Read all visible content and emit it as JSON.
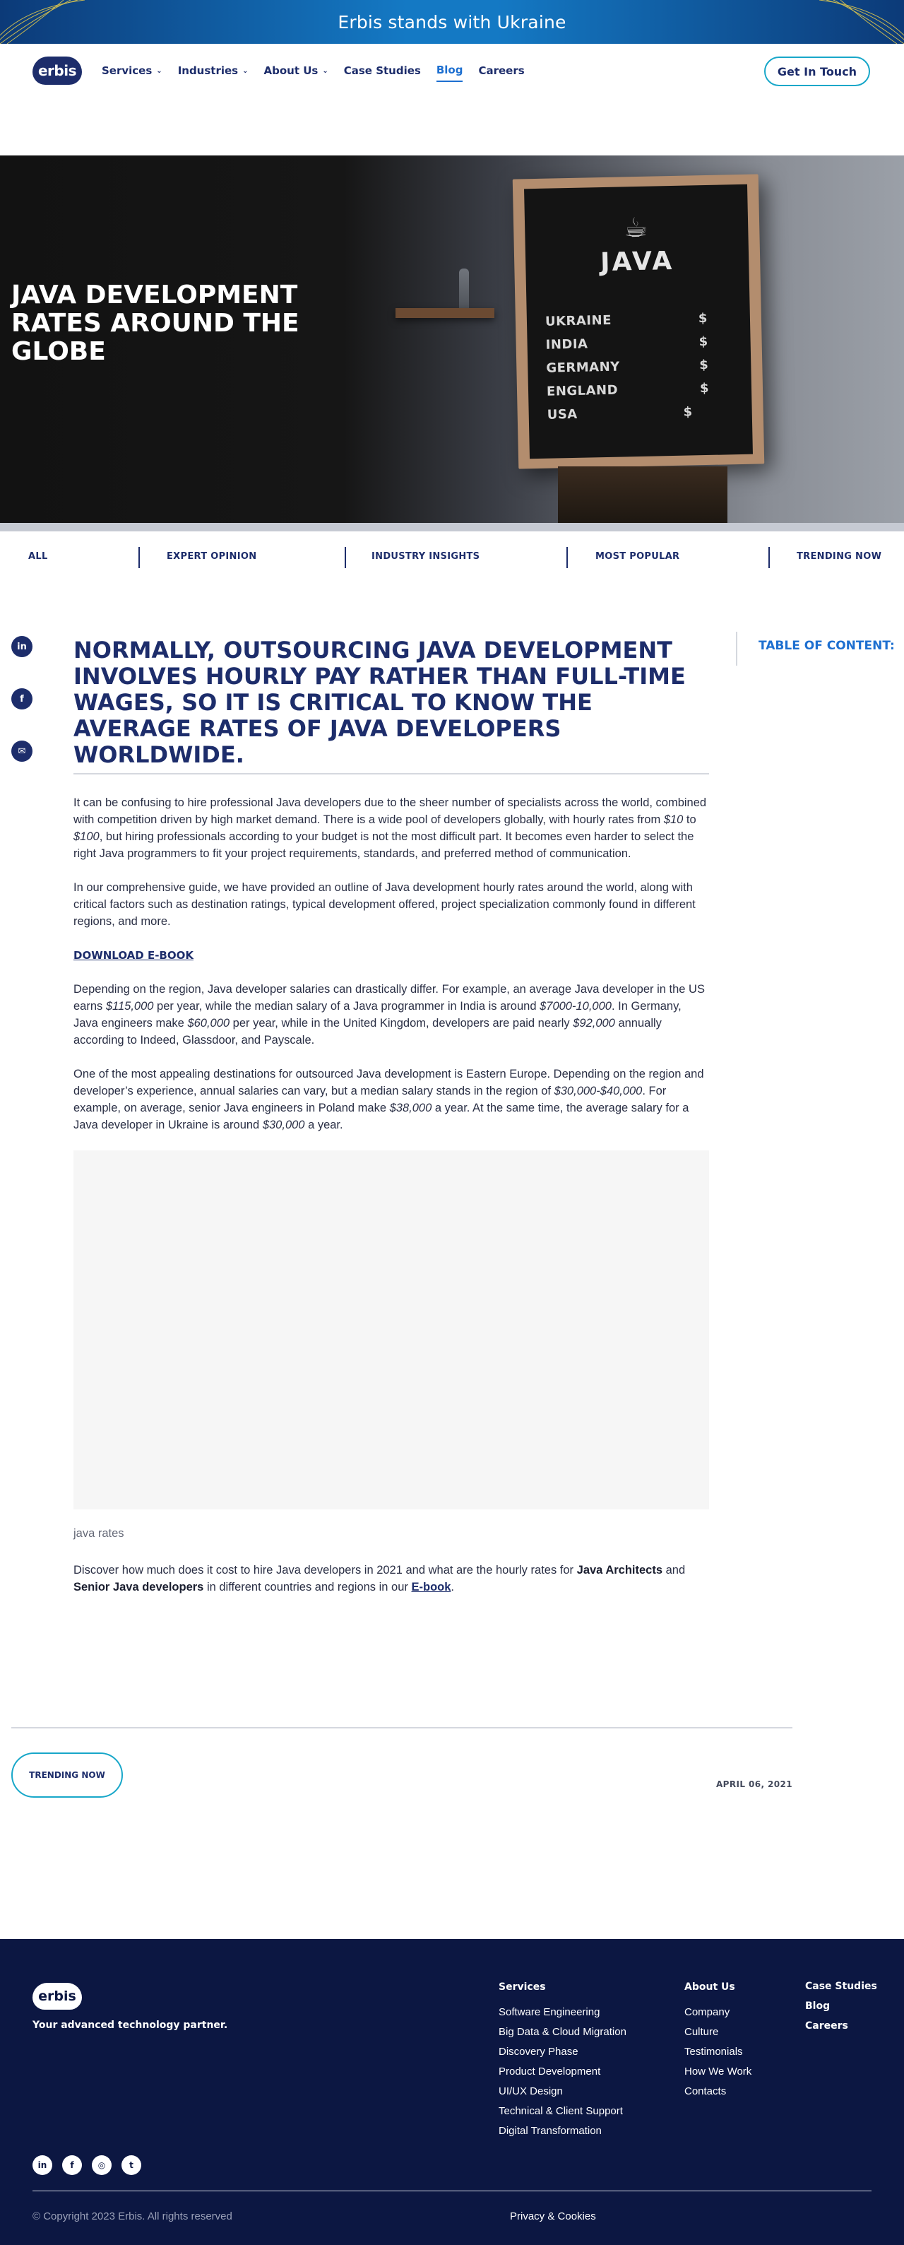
{
  "banner": {
    "text": "Erbis stands with Ukraine"
  },
  "header": {
    "logo": "erbis",
    "nav": [
      {
        "label": "Services",
        "dropdown": true
      },
      {
        "label": "Industries",
        "dropdown": true
      },
      {
        "label": "About Us",
        "dropdown": true
      },
      {
        "label": "Case Studies",
        "dropdown": false
      },
      {
        "label": "Blog",
        "dropdown": false,
        "active": true
      },
      {
        "label": "Careers",
        "dropdown": false
      }
    ],
    "cta": "Get In Touch"
  },
  "hero": {
    "title": "JAVA DEVELOPMENT RATES AROUND THE GLOBE",
    "board": {
      "heading": "JAVA",
      "rows": [
        {
          "country": "UKRAINE",
          "symbol": "$"
        },
        {
          "country": "INDIA",
          "symbol": "$"
        },
        {
          "country": "GERMANY",
          "symbol": "$"
        },
        {
          "country": "ENGLAND",
          "symbol": "$"
        },
        {
          "country": "USA",
          "symbol": "$"
        }
      ]
    }
  },
  "categories": [
    "ALL",
    "EXPERT OPINION",
    "INDUSTRY INSIGHTS",
    "MOST POPULAR",
    "TRENDING NOW"
  ],
  "article": {
    "title": "NORMALLY, OUTSOURCING JAVA DEVELOPMENT INVOLVES HOURLY PAY RATHER THAN FULL-TIME WAGES, SO IT IS CRITICAL TO KNOW THE AVERAGE RATES OF JAVA DEVELOPERS WORLDWIDE.",
    "toc_label": "TABLE OF CONTENT:",
    "p1": {
      "a": "It can be confusing to hire professional Java developers due to the sheer number of specialists across the world, combined with competition driven by high market demand. There is a wide pool of developers globally, with hourly rates from ",
      "b": "$10",
      "c": " to ",
      "d": "$100",
      "e": ", but hiring professionals according to your budget is not the most difficult part. It becomes even harder to select the right Java programmers to fit your project requirements, standards, and preferred method of communication."
    },
    "p2": "In our comprehensive guide, we have provided an outline of Java development hourly rates around the world, along with critical factors such as destination ratings, typical development offered, project specialization commonly found in different regions, and more.",
    "download_label": "DOWNLOAD E-BOOK",
    "p3": {
      "a": "Depending on the region, Java developer salaries can drastically differ. For example, an average Java developer in the US earns ",
      "b": "$115,000",
      "c": " per year, while the median salary of a Java programmer in India is around ",
      "d": "$7000-10,000",
      "e": ". In Germany, Java engineers make ",
      "f": "$60,000",
      "g": " per year, while in the United Kingdom, developers are paid nearly ",
      "h": "$92,000",
      "i": " annually according to Indeed, Glassdoor, and Payscale."
    },
    "p4": {
      "a": "One of the most appealing destinations for outsourced Java development is Eastern Europe. Depending on the region and developer’s experience, annual salaries can vary, but a median salary stands in the region of ",
      "b": "$30,000-$40,000",
      "c": ". For example, on average, senior Java engineers in Poland make ",
      "d": "$38,000",
      "e": " a year. At the same time, the average salary for a Java developer in Ukraine is around ",
      "f": "$30,000",
      "g": " a year."
    },
    "caption": "java rates",
    "p5": {
      "a": "Discover how much does it cost to hire Java developers in 2021 and what are the hourly rates for ",
      "b": "Java Architects",
      "c": " and ",
      "d": "Senior Java developers",
      "e": " in different countries and regions in our ",
      "f": "E-book",
      "g": "."
    },
    "tag_button": "TRENDING NOW",
    "date": "APRIL 06, 2021"
  },
  "share": [
    {
      "icon": "linkedin-icon",
      "glyph": "in"
    },
    {
      "icon": "facebook-icon",
      "glyph": "f"
    },
    {
      "icon": "email-icon",
      "glyph": "✉"
    }
  ],
  "footer": {
    "logo": "erbis",
    "tagline": "Your advanced technology partner.",
    "services_title": "Services",
    "services": [
      "Software Engineering",
      "Big Data & Cloud Migration",
      "Discovery Phase",
      "Product Development",
      "UI/UX Design",
      "Technical & Client Support",
      "Digital Transformation"
    ],
    "about_title": "About Us",
    "about": [
      "Company",
      "Culture",
      "Testimonials",
      "How We Work",
      "Contacts"
    ],
    "extra": [
      "Case Studies",
      "Blog",
      "Careers"
    ],
    "social": [
      {
        "icon": "linkedin-icon",
        "glyph": "in"
      },
      {
        "icon": "facebook-icon",
        "glyph": "f"
      },
      {
        "icon": "instagram-icon",
        "glyph": "◎"
      },
      {
        "icon": "twitter-icon",
        "glyph": "t"
      }
    ],
    "copyright": "© Copyright 2023 Erbis. All rights reserved",
    "privacy": "Privacy & Cookies"
  },
  "colors": {
    "navy": "#1d2d6b",
    "accent": "#1d6fd0",
    "outline": "#18a7c9",
    "footer_bg": "#0c1742"
  }
}
